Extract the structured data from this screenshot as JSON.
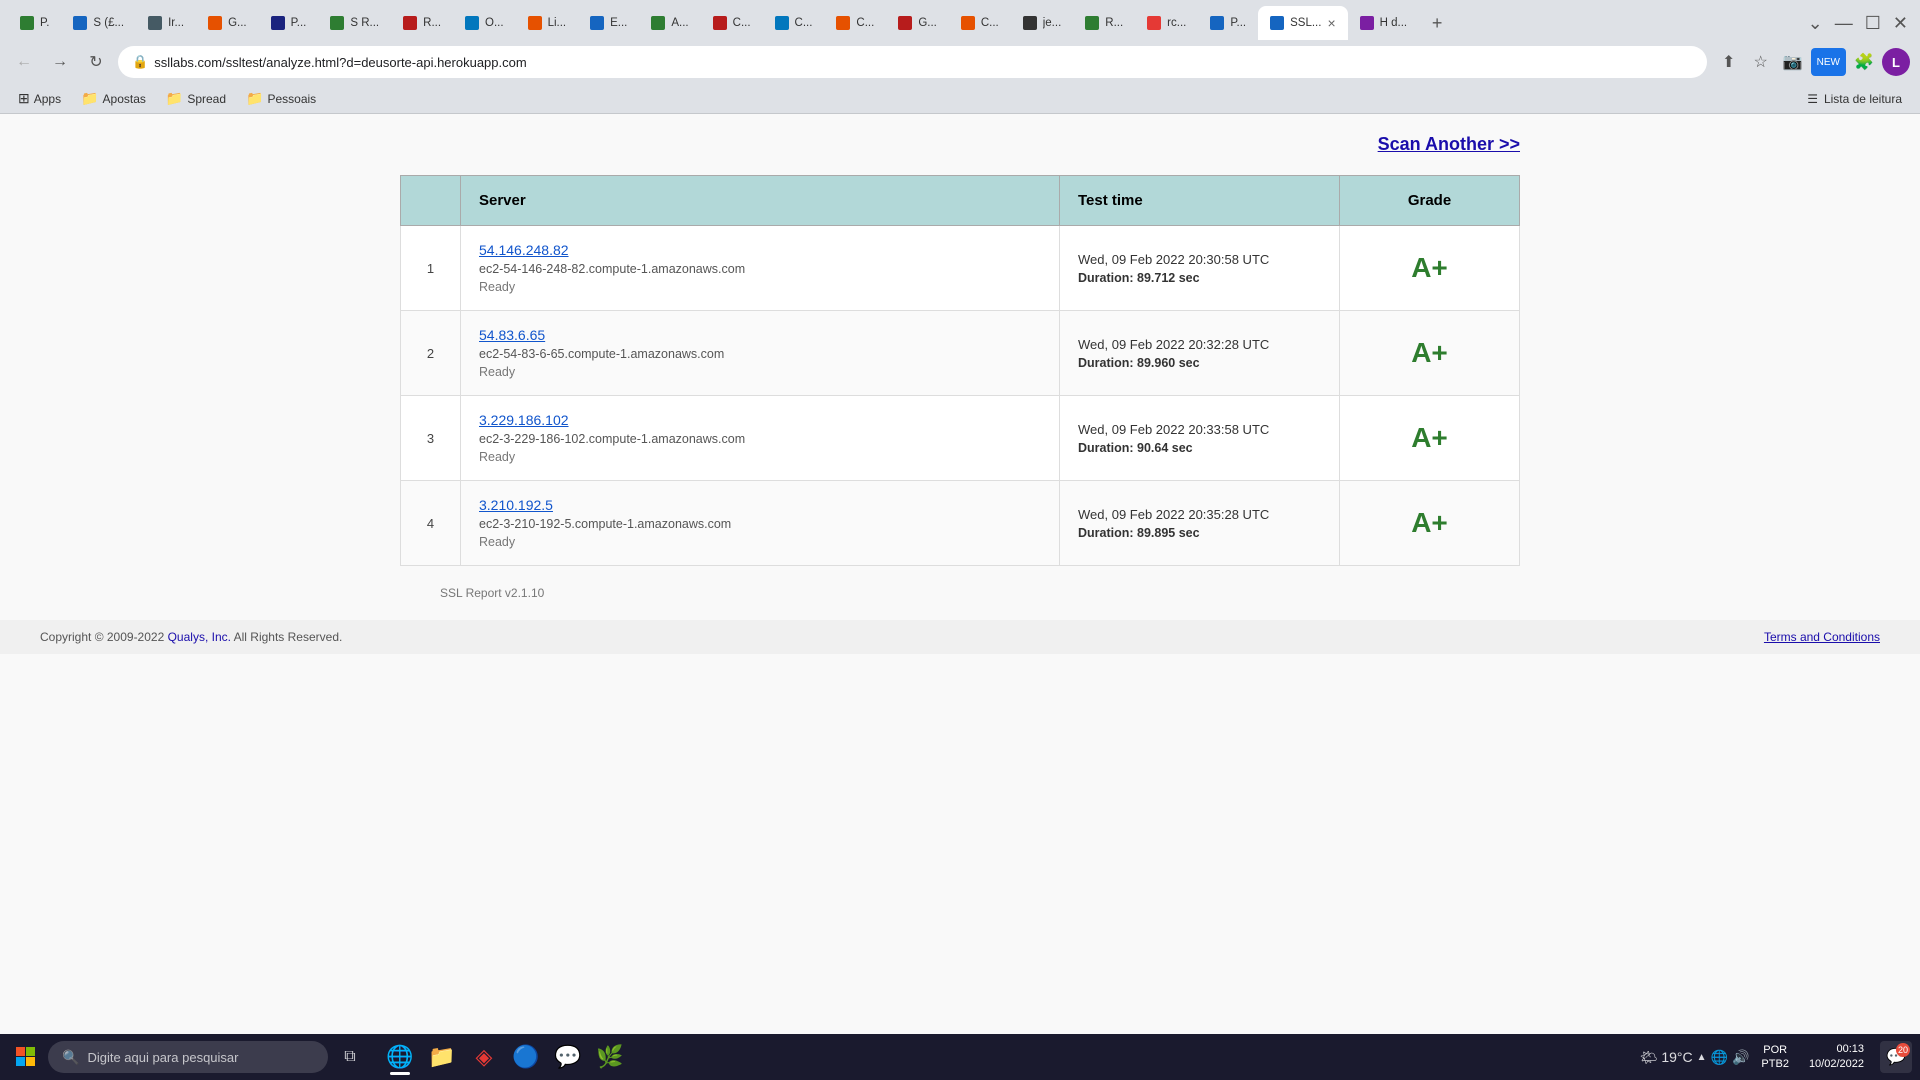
{
  "browser": {
    "url": "ssllabs.com/ssltest/analyze.html?d=deusorte-api.herokuapp.com",
    "url_full": "ssllabs.com/ssltest/analyze.html?d=deusorte-api.herokuapp.com"
  },
  "tabs": [
    {
      "label": "P..",
      "active": false,
      "favicon_color": "#2e7d32"
    },
    {
      "label": "S (£...",
      "active": false,
      "favicon_color": "#1565c0"
    },
    {
      "label": "Ir...",
      "active": false,
      "favicon_color": "#37474f"
    },
    {
      "label": "G...",
      "active": false,
      "favicon_color": "#e65100"
    },
    {
      "label": "P...",
      "active": false,
      "favicon_color": "#1a237e"
    },
    {
      "label": "S R...",
      "active": false,
      "favicon_color": "#2e7d32"
    },
    {
      "label": "R...",
      "active": false,
      "favicon_color": "#b71c1c"
    },
    {
      "label": "O...",
      "active": false,
      "favicon_color": "#0277bd"
    },
    {
      "label": "Li...",
      "active": false,
      "favicon_color": "#e65100"
    },
    {
      "label": "E...",
      "active": false,
      "favicon_color": "#1565c0"
    },
    {
      "label": "A...",
      "active": false,
      "favicon_color": "#2e7d32"
    },
    {
      "label": "C...",
      "active": false,
      "favicon_color": "#b71c1c"
    },
    {
      "label": "C...",
      "active": false,
      "favicon_color": "#0277bd"
    },
    {
      "label": "C...",
      "active": false,
      "favicon_color": "#e65100"
    },
    {
      "label": "G...",
      "active": false,
      "favicon_color": "#b71c1c"
    },
    {
      "label": "C...",
      "active": false,
      "favicon_color": "#e65100"
    },
    {
      "label": "je...",
      "active": false,
      "favicon_color": "#333"
    },
    {
      "label": "R...",
      "active": false,
      "favicon_color": "#2e7d32"
    },
    {
      "label": "rc...",
      "active": false,
      "favicon_color": "#e53935"
    },
    {
      "label": "P...",
      "active": false,
      "favicon_color": "#1565c0"
    },
    {
      "label": "SSL...",
      "active": true,
      "favicon_color": "#1565c0"
    },
    {
      "label": "H d...",
      "active": false,
      "favicon_color": "#7b1fa2"
    }
  ],
  "bookmarks": {
    "apps_label": "Apps",
    "items": [
      {
        "label": "Apostas",
        "type": "folder"
      },
      {
        "label": "Spread",
        "type": "folder"
      },
      {
        "label": "Pessoais",
        "type": "folder"
      }
    ],
    "reading_list_label": "Lista de leitura"
  },
  "page": {
    "scan_another_label": "Scan Another >>",
    "scan_another_url": "#",
    "table": {
      "headers": [
        "",
        "Server",
        "Test time",
        "Grade"
      ],
      "rows": [
        {
          "num": "1",
          "ip": "54.146.248.82",
          "hostname": "ec2-54-146-248-82.compute-1.amazonaws.com",
          "status": "Ready",
          "test_time": "Wed, 09 Feb 2022 20:30:58 UTC",
          "duration": "Duration: 89.712 sec",
          "grade": "A+"
        },
        {
          "num": "2",
          "ip": "54.83.6.65",
          "hostname": "ec2-54-83-6-65.compute-1.amazonaws.com",
          "status": "Ready",
          "test_time": "Wed, 09 Feb 2022 20:32:28 UTC",
          "duration": "Duration: 89.960 sec",
          "grade": "A+"
        },
        {
          "num": "3",
          "ip": "3.229.186.102",
          "hostname": "ec2-3-229-186-102.compute-1.amazonaws.com",
          "status": "Ready",
          "test_time": "Wed, 09 Feb 2022 20:33:58 UTC",
          "duration": "Duration: 90.64 sec",
          "grade": "A+"
        },
        {
          "num": "4",
          "ip": "3.210.192.5",
          "hostname": "ec2-3-210-192-5.compute-1.amazonaws.com",
          "status": "Ready",
          "test_time": "Wed, 09 Feb 2022 20:35:28 UTC",
          "duration": "Duration: 89.895 sec",
          "grade": "A+"
        }
      ]
    },
    "report_version": "SSL Report v2.1.10",
    "copyright": "Copyright © 2009-2022 Qualys, Inc. All Rights Reserved.",
    "terms_label": "Terms and Conditions"
  },
  "taskbar": {
    "search_placeholder": "Digite aqui para pesquisar",
    "weather": "19°C",
    "time": "00:13",
    "date": "10/02/2022",
    "lang": "POR\nPTB2",
    "notification_count": "20",
    "profile_initial": "L"
  }
}
